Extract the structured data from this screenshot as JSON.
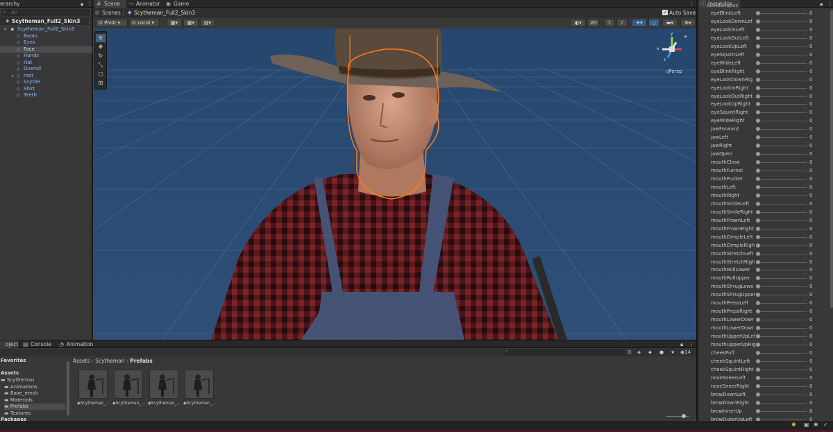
{
  "hierarchy": {
    "tab": "Hierarchy",
    "tab_visible": "erarchy",
    "search_placeholder": "All",
    "scene_name": "Scytheman_Full2_Skin3",
    "root_object": "Scytheman_Full2_Skin3",
    "children": [
      "Boots",
      "Eyes",
      "Face",
      "Hands",
      "Hat",
      "Overall",
      "root",
      "Scythe",
      "Shirt",
      "Teeth"
    ],
    "selected": "Face"
  },
  "scene": {
    "tabs": [
      "Scene",
      "Animator",
      "Game"
    ],
    "breadcrumb_root": "Scenes",
    "breadcrumb_current": "Scytheman_Full2_Skin3",
    "auto_save": "Auto Save",
    "pivot": "Pivot",
    "local": "Local",
    "mode_2d": "2D",
    "persp": "Persp",
    "gizmo_axes": [
      "y",
      "x",
      "z"
    ]
  },
  "inspector": {
    "tab": "Inspector",
    "header_cut": "blendShapes",
    "blendshapes": [
      {
        "name": "eyeBlinkLeft",
        "value": "0"
      },
      {
        "name": "eyeLookDownLef",
        "value": "0"
      },
      {
        "name": "eyeLookInLeft",
        "value": "0"
      },
      {
        "name": "eyeLookOutLeft",
        "value": "0"
      },
      {
        "name": "eyeLookUpLeft",
        "value": "0"
      },
      {
        "name": "eyeSquintLeft",
        "value": "0"
      },
      {
        "name": "eyeWideLeft",
        "value": "0"
      },
      {
        "name": "eyeBlinkRight",
        "value": "0"
      },
      {
        "name": "eyeLookDownRig",
        "value": "0"
      },
      {
        "name": "eyeLookInRight",
        "value": "0"
      },
      {
        "name": "eyeLookOutRight",
        "value": "0"
      },
      {
        "name": "eyeLookUpRight",
        "value": "0"
      },
      {
        "name": "eyeSquintRight",
        "value": "0"
      },
      {
        "name": "eyeWideRight",
        "value": "0"
      },
      {
        "name": "jawForward",
        "value": "0"
      },
      {
        "name": "jawLeft",
        "value": "0"
      },
      {
        "name": "jawRight",
        "value": "0"
      },
      {
        "name": "jawOpen",
        "value": "0"
      },
      {
        "name": "mouthClose",
        "value": "0"
      },
      {
        "name": "mouthFunnel",
        "value": "0"
      },
      {
        "name": "mouthPucker",
        "value": "0"
      },
      {
        "name": "mouthLeft",
        "value": "0"
      },
      {
        "name": "mouthRight",
        "value": "0"
      },
      {
        "name": "mouthSmileLeft",
        "value": "0"
      },
      {
        "name": "mouthSmileRight",
        "value": "0"
      },
      {
        "name": "mouthFrownLeft",
        "value": "0"
      },
      {
        "name": "mouthFrownRight",
        "value": "0"
      },
      {
        "name": "mouthDimpleLeft",
        "value": "0"
      },
      {
        "name": "mouthDimpleRigh",
        "value": "0"
      },
      {
        "name": "mouthStretchLeft",
        "value": "0"
      },
      {
        "name": "mouthStretchRigh",
        "value": "0"
      },
      {
        "name": "mouthRollLower",
        "value": "0"
      },
      {
        "name": "mouthRollUpper",
        "value": "0"
      },
      {
        "name": "mouthShrugLowe",
        "value": "0"
      },
      {
        "name": "mouthShrugUpper",
        "value": "0"
      },
      {
        "name": "mouthPressLeft",
        "value": "0"
      },
      {
        "name": "mouthPressRight",
        "value": "0"
      },
      {
        "name": "mouthLowerDowr",
        "value": "0"
      },
      {
        "name": "mouthLowerDowr",
        "value": "0"
      },
      {
        "name": "mouthUpperUpLef",
        "value": "0"
      },
      {
        "name": "mouthUpperUpRig",
        "value": "0"
      },
      {
        "name": "cheekPuff",
        "value": "0"
      },
      {
        "name": "cheekSquintLeft",
        "value": "0"
      },
      {
        "name": "cheekSquintRight",
        "value": "0"
      },
      {
        "name": "noseSneerLeft",
        "value": "0"
      },
      {
        "name": "noseSneerRight",
        "value": "0"
      },
      {
        "name": "browDownLeft",
        "value": "0"
      },
      {
        "name": "browDownRight",
        "value": "0"
      },
      {
        "name": "browInnerUp",
        "value": "0"
      },
      {
        "name": "browOuterUpLeft",
        "value": "0"
      }
    ]
  },
  "project": {
    "tabs": [
      "Project",
      "Console",
      "Animation"
    ],
    "tab_project_visible": "oject",
    "favorites": "Favorites",
    "assets": "Assets",
    "tree": [
      "Scytheman",
      "Animations",
      "Base_mesh",
      "Materials",
      "Prefabs",
      "Textures"
    ],
    "packages": "Packages",
    "breadcrumb": [
      "Assets",
      "Scytheman",
      "Prefabs"
    ],
    "search_placeholder": "",
    "hidden_count": "14",
    "prefabs": [
      "Scytheman_...",
      "Scytheman_...",
      "Scytheman_...",
      "Scytheman_..."
    ]
  },
  "colors": {
    "selection_outline": "#ff7a1a",
    "viewport_sky": "#25476d",
    "accent": "#8fb8ff"
  }
}
